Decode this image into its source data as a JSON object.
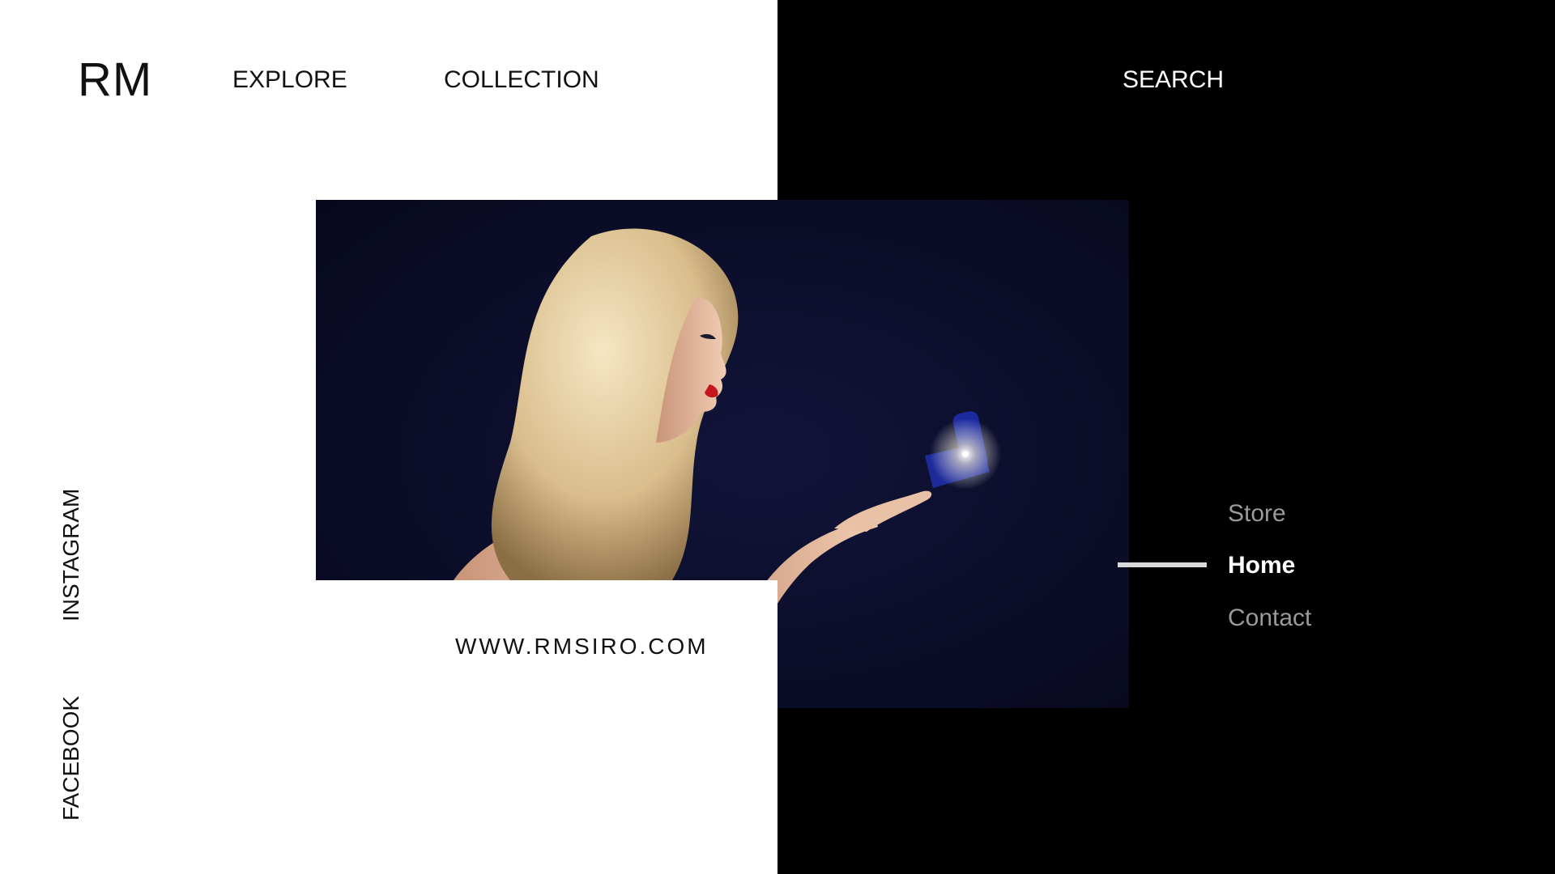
{
  "brand": {
    "logo": "RM"
  },
  "nav": {
    "explore": "EXPLORE",
    "collection": "COLLECTION",
    "search": "SEARCH"
  },
  "social": {
    "instagram": "INSTAGRAM",
    "facebook": "FACEBOOK"
  },
  "website": {
    "url": "WWW.RMSIRO.COM"
  },
  "side_menu": {
    "items": [
      {
        "label": "Store",
        "active": false
      },
      {
        "label": "Home",
        "active": true
      },
      {
        "label": "Contact",
        "active": false
      }
    ]
  },
  "colors": {
    "left_background": "#ffffff",
    "right_background": "#000000",
    "photo_background": "#0b0c24",
    "active_menu": "#ffffff",
    "inactive_menu": "#9a9a9a"
  }
}
